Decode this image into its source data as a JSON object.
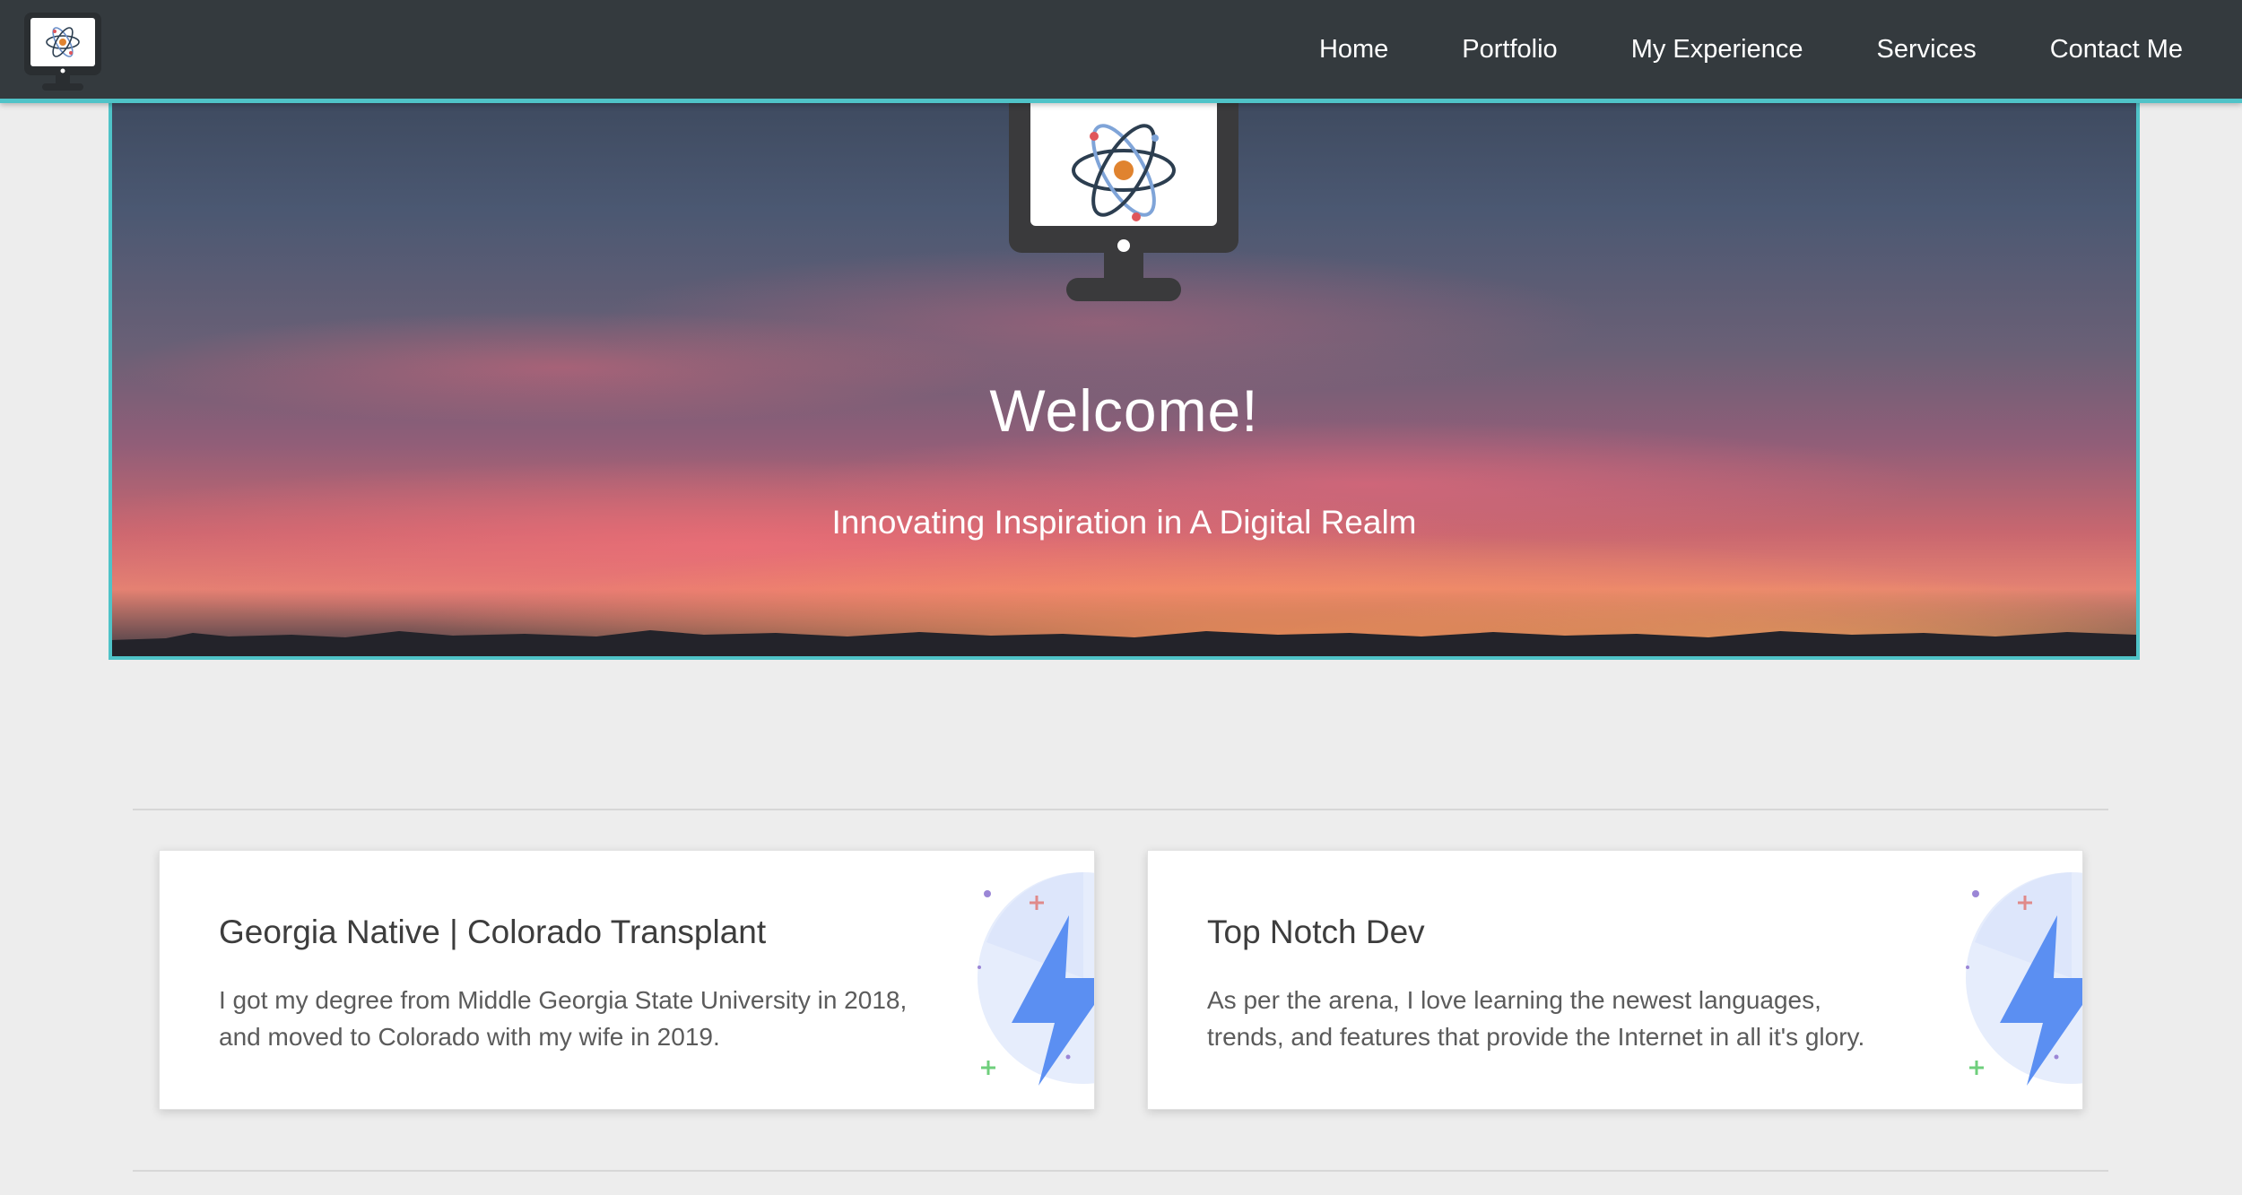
{
  "nav": {
    "links": [
      "Home",
      "Portfolio",
      "My Experience",
      "Services",
      "Contact Me"
    ]
  },
  "hero": {
    "title": "Welcome!",
    "subtitle": "Innovating Inspiration in A Digital Realm"
  },
  "cards": [
    {
      "title": "Georgia Native | Colorado Transplant",
      "text": "I got my degree from Middle Georgia State University in 2018, and moved to Colorado with my wife in 2019.",
      "icon": "lightning-bolt-icon"
    },
    {
      "title": "Top Notch Dev",
      "text": "As per the arena, I love learning the newest languages, trends, and features that provide the Internet in all it's glory.",
      "icon": "lightning-bolt-icon"
    }
  ],
  "colors": {
    "navbar": "#343a3e",
    "accent": "#4fc3c8",
    "page_background": "#ededed",
    "bolt": "#5b8ff2"
  }
}
